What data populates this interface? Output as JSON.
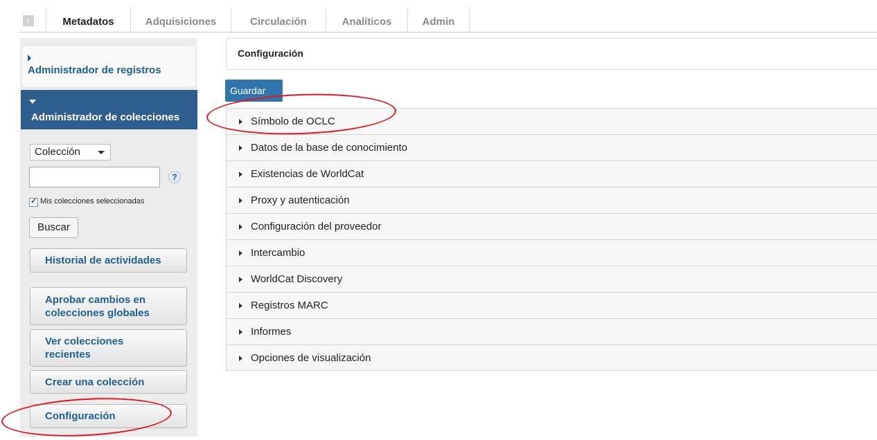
{
  "topnav": {
    "collapse_icon": "chevron-left-icon",
    "tabs": [
      {
        "label": "Metadatos",
        "active": true
      },
      {
        "label": "Adquisiciones",
        "active": false
      },
      {
        "label": "Circulación",
        "active": false
      },
      {
        "label": "Analíticos",
        "active": false
      },
      {
        "label": "Admin",
        "active": false
      }
    ]
  },
  "sidebar": {
    "record_manager": "Administrador de registros",
    "collection_manager": "Administrador de colecciones",
    "collection_select": "Colección",
    "search_value": "",
    "help_icon": "?",
    "my_collections_checked": true,
    "my_collections_label": "Mis colecciones seleccionadas",
    "search_button": "Buscar",
    "buttons": {
      "activity_history": "Historial de actividades",
      "approve_changes_line1": "Aprobar cambios en",
      "approve_changes_line2": "colecciones globales",
      "recent_line1": "Ver colecciones",
      "recent_line2": "recientes",
      "create": "Crear una colección",
      "settings": "Configuración"
    }
  },
  "main": {
    "title": "Configuración",
    "save_button": "Guardar",
    "sections": [
      "Símbolo de OCLC",
      "Datos de la base de conocimiento",
      "Existencias de WorldCat",
      "Proxy y autenticación",
      "Configuración del proveedor",
      "Intercambio",
      "WorldCat Discovery",
      "Registros MARC",
      "Informes",
      "Opciones de visualización"
    ]
  },
  "colors": {
    "accent": "#2d5e8e",
    "link": "#1e5f95",
    "save_button": "#3274ac",
    "annotation": "#e2161b"
  }
}
